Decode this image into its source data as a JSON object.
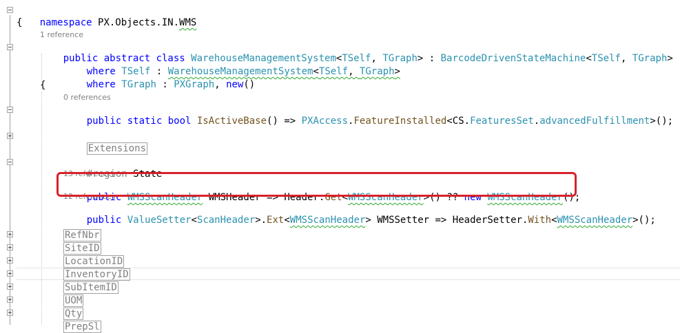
{
  "editor": {
    "namespace_kw": "namespace",
    "namespace_name": "PX.Objects.IN.",
    "namespace_wms": "WMS",
    "open_brace": "{",
    "class_refs": "1 reference",
    "class_line": {
      "mods": "public abstract class ",
      "name": "WarehouseManagementSystem",
      "lt": "<",
      "tself": "TSelf",
      "comma": ", ",
      "tgraph": "TGraph",
      "gt_colon": "> : ",
      "base": "BarcodeDrivenStateMachine",
      "lt2": "<",
      "tself2": "TSelf",
      "comma2": ", ",
      "tgraph2": "TGraph",
      "gt2": ">"
    },
    "where1": {
      "kw": "where",
      "tself": " TSelf",
      "colon": " : ",
      "type": "WarehouseManagementSystem",
      "lt": "<",
      "tself2": "TSelf",
      "comma": ", ",
      "tgraph": "TGraph",
      "gt": ">"
    },
    "where2": {
      "kw": "where",
      "tgraph": " TGraph",
      "colon": " : ",
      "type": "PXGraph",
      "comma": ", ",
      "new_kw": "new",
      "parens": "()"
    },
    "inner_brace": "{",
    "isactive_refs": "0 references",
    "isactive": {
      "mods": "public static bool ",
      "name": "IsActiveBase",
      "paren_arrow": "() => ",
      "cls": "PXAccess",
      "dot": ".",
      "method": "FeatureInstalled",
      "lt": "<CS.",
      "fs": "FeaturesSet",
      "dot2": ".",
      "prop": "advancedFulfillment",
      "end": ">();"
    },
    "extensions": "Extensions",
    "region_kw": "#region",
    "region_name": " State",
    "header_refs": "13 references",
    "header": {
      "mods": "public ",
      "type": "WMSScanHeader",
      "name": " WMSHeader => Header.",
      "get": "Get",
      "lt": "<",
      "type2": "WMSScanHeader",
      "mid": ">() ?? ",
      "new_kw": "new",
      "sp": " ",
      "type3": "WMSScanHeader",
      "end": "();"
    },
    "setter_refs": "12 references",
    "setter": {
      "mods": "public ",
      "vs": "ValueSetter",
      "lt": "<",
      "sh": "ScanHeader",
      "gtdot": ">.",
      "ext": "Ext",
      "lt2": "<",
      "type": "WMSScanHeader",
      "mid": "> WMSSetter => HeaderSetter.",
      "with": "With",
      "lt3": "<",
      "type2": "WMSScanHeader",
      "end": ">();"
    },
    "collapsed": [
      "RefNbr",
      "SiteID",
      "LocationID",
      "InventoryID",
      "SubItemID",
      "UOM",
      "Qty",
      "PrepSl"
    ]
  },
  "colors": {
    "keyword": "#0000ff",
    "type": "#2b91af",
    "method": "#74531f",
    "highlight_box": "#d8212a",
    "squiggle": "#2da82d"
  }
}
